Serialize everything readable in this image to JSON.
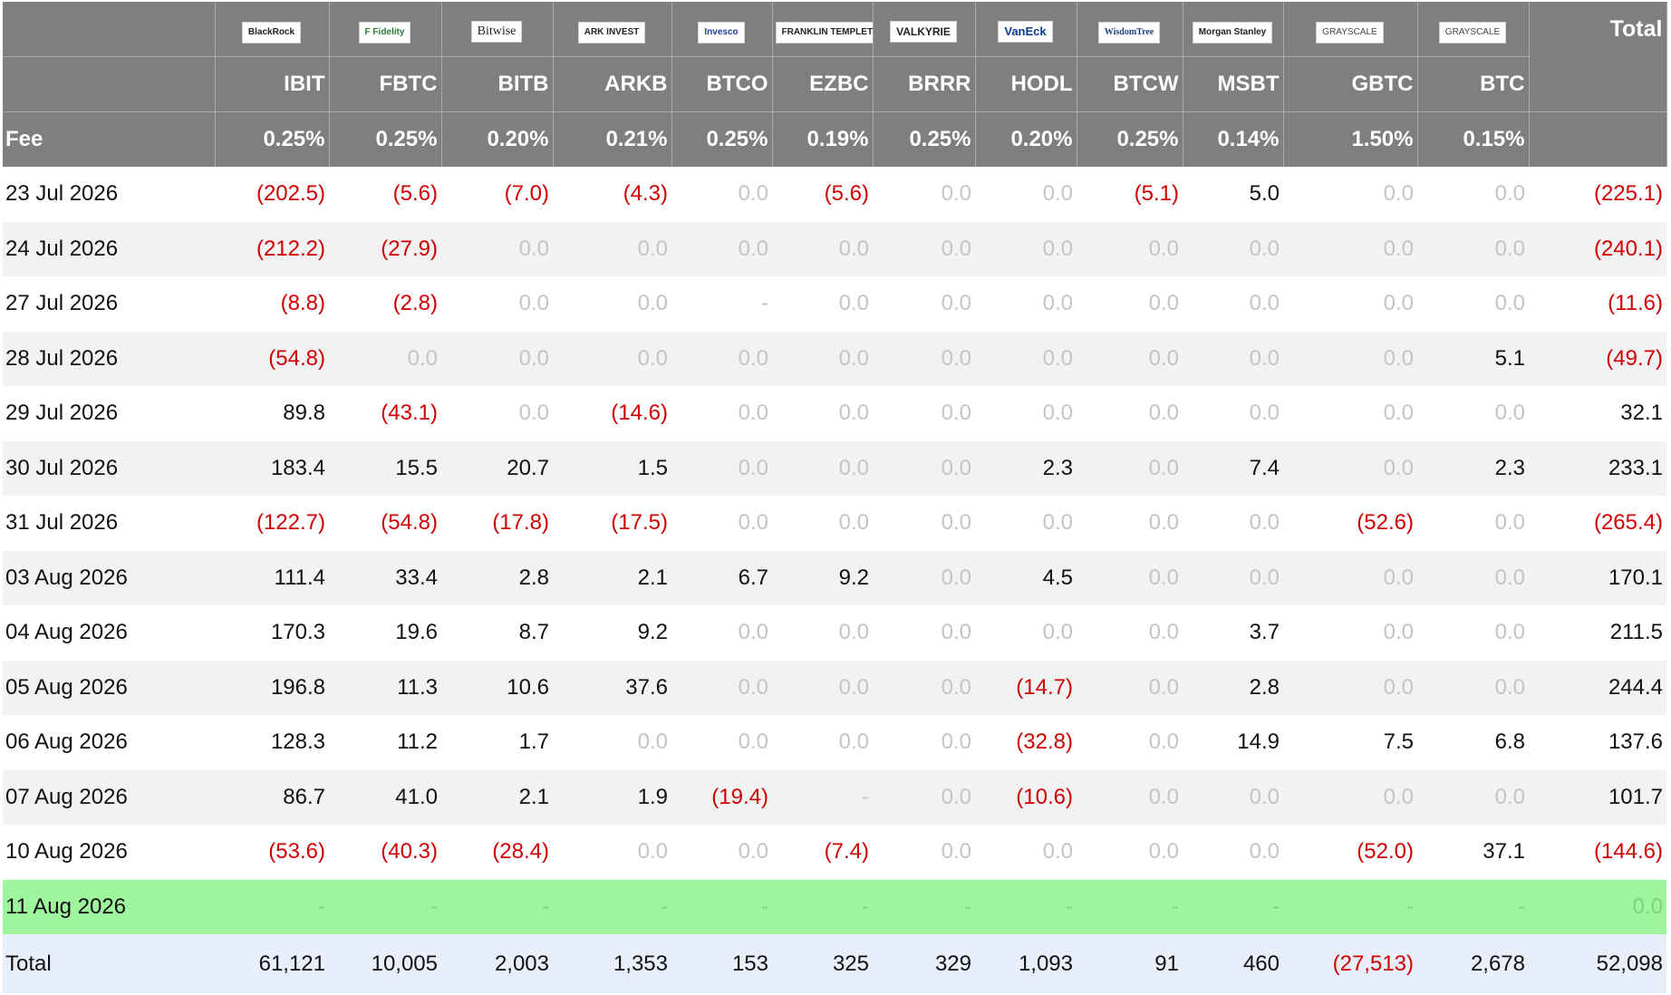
{
  "table": {
    "total_header": "Total",
    "fee_label": "Fee",
    "issuers": [
      {
        "logo": "BlackRock",
        "logo_class": "",
        "ticker": "IBIT",
        "fee": "0.25%"
      },
      {
        "logo": "F Fidelity",
        "logo_class": "fidelity",
        "ticker": "FBTC",
        "fee": "0.25%"
      },
      {
        "logo": "Bitwise",
        "logo_class": "bitwise",
        "ticker": "BITB",
        "fee": "0.20%"
      },
      {
        "logo": "ARK INVEST",
        "logo_class": "",
        "ticker": "ARKB",
        "fee": "0.21%"
      },
      {
        "logo": "Invesco",
        "logo_class": "invesco",
        "ticker": "BTCO",
        "fee": "0.25%"
      },
      {
        "logo": "FRANKLIN TEMPLETON",
        "logo_class": "",
        "ticker": "EZBC",
        "fee": "0.19%"
      },
      {
        "logo": "VALKYRIE",
        "logo_class": "valkyrie",
        "ticker": "BRRR",
        "fee": "0.25%"
      },
      {
        "logo": "VanEck",
        "logo_class": "vaneck",
        "ticker": "HODL",
        "fee": "0.20%"
      },
      {
        "logo": "WisdomTree",
        "logo_class": "wisdom",
        "ticker": "BTCW",
        "fee": "0.25%"
      },
      {
        "logo": "Morgan Stanley",
        "logo_class": "",
        "ticker": "MSBT",
        "fee": "0.14%"
      },
      {
        "logo": "GRAYSCALE",
        "logo_class": "gray",
        "ticker": "GBTC",
        "fee": "1.50%"
      },
      {
        "logo": "GRAYSCALE",
        "logo_class": "gray",
        "ticker": "BTC",
        "fee": "0.15%"
      }
    ],
    "rows": [
      {
        "date": "23 Jul 2026",
        "values": [
          "(202.5)",
          "(5.6)",
          "(7.0)",
          "(4.3)",
          "0.0",
          "(5.6)",
          "0.0",
          "0.0",
          "(5.1)",
          "5.0",
          "0.0",
          "0.0"
        ],
        "total": "(225.1)"
      },
      {
        "date": "24 Jul 2026",
        "values": [
          "(212.2)",
          "(27.9)",
          "0.0",
          "0.0",
          "0.0",
          "0.0",
          "0.0",
          "0.0",
          "0.0",
          "0.0",
          "0.0",
          "0.0"
        ],
        "total": "(240.1)"
      },
      {
        "date": "27 Jul 2026",
        "values": [
          "(8.8)",
          "(2.8)",
          "0.0",
          "0.0",
          "-",
          "0.0",
          "0.0",
          "0.0",
          "0.0",
          "0.0",
          "0.0",
          "0.0"
        ],
        "total": "(11.6)"
      },
      {
        "date": "28 Jul 2026",
        "values": [
          "(54.8)",
          "0.0",
          "0.0",
          "0.0",
          "0.0",
          "0.0",
          "0.0",
          "0.0",
          "0.0",
          "0.0",
          "0.0",
          "5.1"
        ],
        "total": "(49.7)"
      },
      {
        "date": "29 Jul 2026",
        "values": [
          "89.8",
          "(43.1)",
          "0.0",
          "(14.6)",
          "0.0",
          "0.0",
          "0.0",
          "0.0",
          "0.0",
          "0.0",
          "0.0",
          "0.0"
        ],
        "total": "32.1"
      },
      {
        "date": "30 Jul 2026",
        "values": [
          "183.4",
          "15.5",
          "20.7",
          "1.5",
          "0.0",
          "0.0",
          "0.0",
          "2.3",
          "0.0",
          "7.4",
          "0.0",
          "2.3"
        ],
        "total": "233.1"
      },
      {
        "date": "31 Jul 2026",
        "values": [
          "(122.7)",
          "(54.8)",
          "(17.8)",
          "(17.5)",
          "0.0",
          "0.0",
          "0.0",
          "0.0",
          "0.0",
          "0.0",
          "(52.6)",
          "0.0"
        ],
        "total": "(265.4)"
      },
      {
        "date": "03 Aug 2026",
        "values": [
          "111.4",
          "33.4",
          "2.8",
          "2.1",
          "6.7",
          "9.2",
          "0.0",
          "4.5",
          "0.0",
          "0.0",
          "0.0",
          "0.0"
        ],
        "total": "170.1"
      },
      {
        "date": "04 Aug 2026",
        "values": [
          "170.3",
          "19.6",
          "8.7",
          "9.2",
          "0.0",
          "0.0",
          "0.0",
          "0.0",
          "0.0",
          "3.7",
          "0.0",
          "0.0"
        ],
        "total": "211.5"
      },
      {
        "date": "05 Aug 2026",
        "values": [
          "196.8",
          "11.3",
          "10.6",
          "37.6",
          "0.0",
          "0.0",
          "0.0",
          "(14.7)",
          "0.0",
          "2.8",
          "0.0",
          "0.0"
        ],
        "total": "244.4"
      },
      {
        "date": "06 Aug 2026",
        "values": [
          "128.3",
          "11.2",
          "1.7",
          "0.0",
          "0.0",
          "0.0",
          "0.0",
          "(32.8)",
          "0.0",
          "14.9",
          "7.5",
          "6.8"
        ],
        "total": "137.6"
      },
      {
        "date": "07 Aug 2026",
        "values": [
          "86.7",
          "41.0",
          "2.1",
          "1.9",
          "(19.4)",
          "-",
          "0.0",
          "(10.6)",
          "0.0",
          "0.0",
          "0.0",
          "0.0"
        ],
        "total": "101.7"
      },
      {
        "date": "10 Aug 2026",
        "values": [
          "(53.6)",
          "(40.3)",
          "(28.4)",
          "0.0",
          "0.0",
          "(7.4)",
          "0.0",
          "0.0",
          "0.0",
          "0.0",
          "(52.0)",
          "37.1"
        ],
        "total": "(144.6)"
      }
    ],
    "current_row": {
      "date": "11 Aug 2026",
      "values": [
        "-",
        "-",
        "-",
        "-",
        "-",
        "-",
        "-",
        "-",
        "-",
        "-",
        "-",
        "-"
      ],
      "total": "0.0"
    },
    "totals_row": {
      "label": "Total",
      "values": [
        "61,121",
        "10,005",
        "2,003",
        "1,353",
        "153",
        "325",
        "329",
        "1,093",
        "91",
        "460",
        "(27,513)",
        "2,678"
      ],
      "total": "52,098"
    }
  },
  "colors": {
    "header_bg": "#7f7f7f",
    "negative": "#d00000",
    "zero": "#c4c4c4",
    "highlight_row": "#9ef59e",
    "totals_bg": "#e8eefa"
  }
}
